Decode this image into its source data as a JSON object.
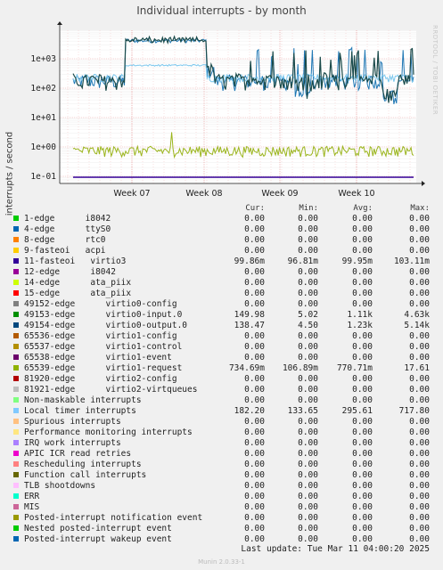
{
  "title": "Individual interrupts - by month",
  "watermark": "RRDTOOL / TOBI OETIKER",
  "ylabel": "interrupts / second",
  "legend_headers": {
    "cur": "Cur:",
    "min": "Min:",
    "avg": "Avg:",
    "max": "Max:"
  },
  "last_update": "Last update:  Tue Mar 11 04:00:20 2025",
  "footer": "Munin 2.0.33-1",
  "chart_data": {
    "type": "line",
    "title": "Individual interrupts - by month",
    "ylabel": "interrupts / second",
    "yscale": "log",
    "ylim": [
      0.05,
      5000
    ],
    "yticks": [
      "1e-01",
      "1e+00",
      "1e+01",
      "1e+02",
      "1e+03"
    ],
    "xticks": [
      "Week 07",
      "Week 08",
      "Week 09",
      "Week 10"
    ],
    "grid": true,
    "series": [
      {
        "name": "49153-edge virtio0-input.0",
        "color": "#1f77b4",
        "description": "high band ~4000 Week 07-08, ~100-400 elsewhere",
        "max": 4630,
        "avg": 1110
      },
      {
        "name": "49154-edge virtio0-output.0",
        "color": "#1a4a4a",
        "max": 5140,
        "avg": 1230
      },
      {
        "name": "Local timer interrupts",
        "color": "#66ccee",
        "avg": 295.61,
        "max": 717.8
      },
      {
        "name": "65539-edge virtio1-request",
        "color": "#8faa16",
        "avg": 0.77,
        "max": 17.61
      },
      {
        "name": "11-fasteoi virtio3",
        "color": "#330099",
        "avg": 0.09995,
        "max": 0.1031
      }
    ]
  },
  "legend": [
    {
      "color": "#00cc00",
      "label": "1-edge      i8042",
      "cur": "0.00",
      "min": "0.00",
      "avg": "0.00",
      "max": "0.00"
    },
    {
      "color": "#0066b3",
      "label": "4-edge      ttyS0",
      "cur": "0.00",
      "min": "0.00",
      "avg": "0.00",
      "max": "0.00"
    },
    {
      "color": "#ff8000",
      "label": "8-edge      rtc0",
      "cur": "0.00",
      "min": "0.00",
      "avg": "0.00",
      "max": "0.00"
    },
    {
      "color": "#ffcc00",
      "label": "9-fasteoi   acpi",
      "cur": "0.00",
      "min": "0.00",
      "avg": "0.00",
      "max": "0.00"
    },
    {
      "color": "#330099",
      "label": "11-fasteoi   virtio3",
      "cur": "99.86m",
      "min": "96.81m",
      "avg": "99.95m",
      "max": "103.11m"
    },
    {
      "color": "#990099",
      "label": "12-edge      i8042",
      "cur": "0.00",
      "min": "0.00",
      "avg": "0.00",
      "max": "0.00"
    },
    {
      "color": "#ccff00",
      "label": "14-edge      ata_piix",
      "cur": "0.00",
      "min": "0.00",
      "avg": "0.00",
      "max": "0.00"
    },
    {
      "color": "#ff0000",
      "label": "15-edge      ata_piix",
      "cur": "0.00",
      "min": "0.00",
      "avg": "0.00",
      "max": "0.00"
    },
    {
      "color": "#808080",
      "label": "49152-edge      virtio0-config",
      "cur": "0.00",
      "min": "0.00",
      "avg": "0.00",
      "max": "0.00"
    },
    {
      "color": "#008f00",
      "label": "49153-edge      virtio0-input.0",
      "cur": "149.98",
      "min": "5.02",
      "avg": "1.11k",
      "max": "4.63k"
    },
    {
      "color": "#00487d",
      "label": "49154-edge      virtio0-output.0",
      "cur": "138.47",
      "min": "4.50",
      "avg": "1.23k",
      "max": "5.14k"
    },
    {
      "color": "#b35a00",
      "label": "65536-edge      virtio1-config",
      "cur": "0.00",
      "min": "0.00",
      "avg": "0.00",
      "max": "0.00"
    },
    {
      "color": "#b38f00",
      "label": "65537-edge      virtio1-control",
      "cur": "0.00",
      "min": "0.00",
      "avg": "0.00",
      "max": "0.00"
    },
    {
      "color": "#6b006b",
      "label": "65538-edge      virtio1-event",
      "cur": "0.00",
      "min": "0.00",
      "avg": "0.00",
      "max": "0.00"
    },
    {
      "color": "#8fb300",
      "label": "65539-edge      virtio1-request",
      "cur": "734.69m",
      "min": "106.89m",
      "avg": "770.71m",
      "max": "17.61"
    },
    {
      "color": "#b30000",
      "label": "81920-edge      virtio2-config",
      "cur": "0.00",
      "min": "0.00",
      "avg": "0.00",
      "max": "0.00"
    },
    {
      "color": "#bebebe",
      "label": "81921-edge      virtio2-virtqueues",
      "cur": "0.00",
      "min": "0.00",
      "avg": "0.00",
      "max": "0.00"
    },
    {
      "color": "#80ff80",
      "label": "Non-maskable interrupts",
      "cur": "0.00",
      "min": "0.00",
      "avg": "0.00",
      "max": "0.00"
    },
    {
      "color": "#80c9ff",
      "label": "Local timer interrupts",
      "cur": "182.20",
      "min": "133.65",
      "avg": "295.61",
      "max": "717.80"
    },
    {
      "color": "#ffc080",
      "label": "Spurious interrupts",
      "cur": "0.00",
      "min": "0.00",
      "avg": "0.00",
      "max": "0.00"
    },
    {
      "color": "#ffe680",
      "label": "Performance monitoring interrupts",
      "cur": "0.00",
      "min": "0.00",
      "avg": "0.00",
      "max": "0.00"
    },
    {
      "color": "#aa80ff",
      "label": "IRQ work interrupts",
      "cur": "0.00",
      "min": "0.00",
      "avg": "0.00",
      "max": "0.00"
    },
    {
      "color": "#ee00cc",
      "label": "APIC ICR read retries",
      "cur": "0.00",
      "min": "0.00",
      "avg": "0.00",
      "max": "0.00"
    },
    {
      "color": "#ff8080",
      "label": "Rescheduling interrupts",
      "cur": "0.00",
      "min": "0.00",
      "avg": "0.00",
      "max": "0.00"
    },
    {
      "color": "#666600",
      "label": "Function call interrupts",
      "cur": "0.00",
      "min": "0.00",
      "avg": "0.00",
      "max": "0.00"
    },
    {
      "color": "#ffbfff",
      "label": "TLB shootdowns",
      "cur": "0.00",
      "min": "0.00",
      "avg": "0.00",
      "max": "0.00"
    },
    {
      "color": "#00ffcc",
      "label": "ERR",
      "cur": "0.00",
      "min": "0.00",
      "avg": "0.00",
      "max": "0.00"
    },
    {
      "color": "#cc6699",
      "label": "MIS",
      "cur": "0.00",
      "min": "0.00",
      "avg": "0.00",
      "max": "0.00"
    },
    {
      "color": "#999900",
      "label": "Posted-interrupt notification event",
      "cur": "0.00",
      "min": "0.00",
      "avg": "0.00",
      "max": "0.00"
    },
    {
      "color": "#00cc00",
      "label": "Nested posted-interrupt event",
      "cur": "0.00",
      "min": "0.00",
      "avg": "0.00",
      "max": "0.00"
    },
    {
      "color": "#0066b3",
      "label": "Posted-interrupt wakeup event",
      "cur": "0.00",
      "min": "0.00",
      "avg": "0.00",
      "max": "0.00"
    }
  ]
}
